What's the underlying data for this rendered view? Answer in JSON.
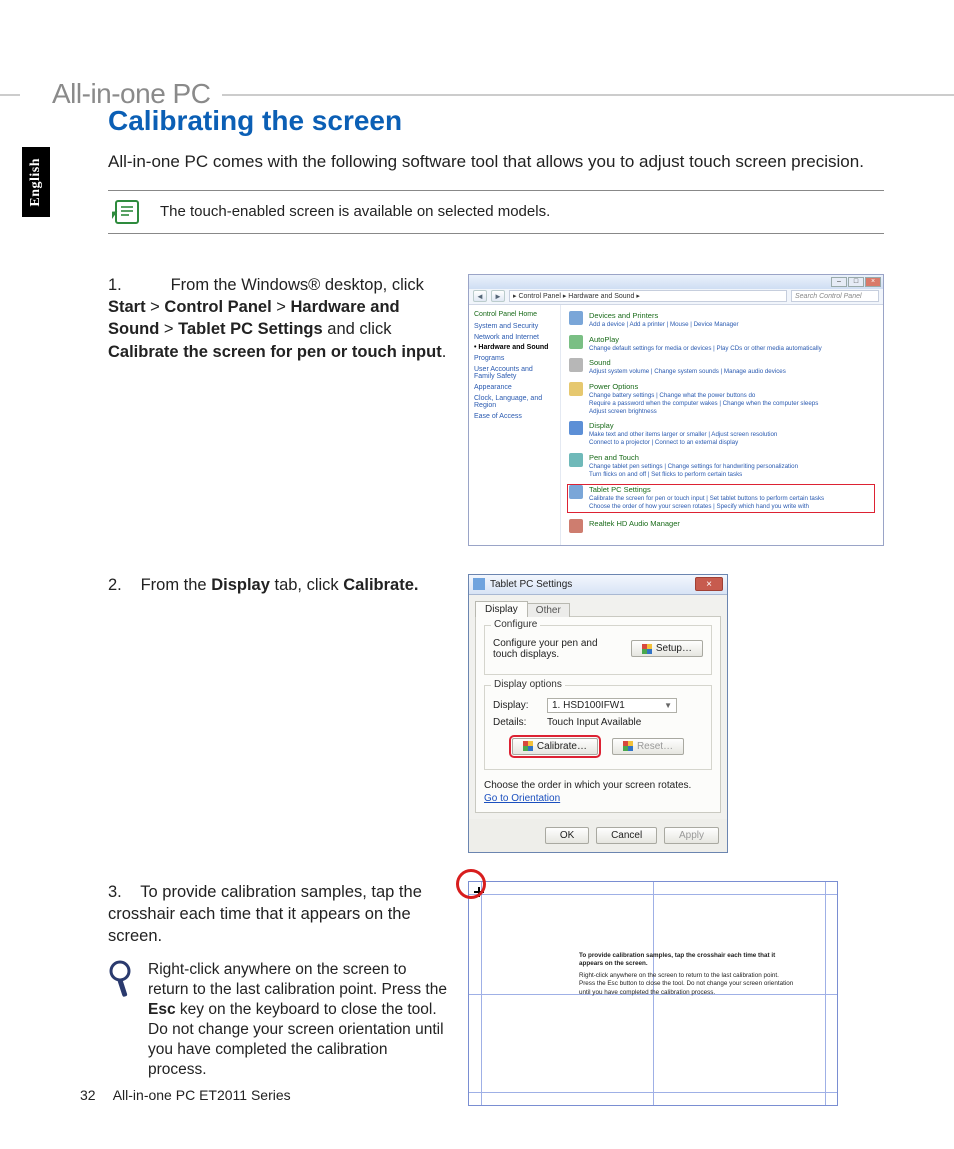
{
  "header": {
    "brand": "All-in-one PC"
  },
  "language_tab": "English",
  "title": "Calibrating the screen",
  "intro": "All-in-one PC comes with the following software tool that allows you to adjust touch screen precision.",
  "note": "The touch-enabled screen is available on selected models.",
  "steps": {
    "s1": {
      "num": "1.",
      "pre": "From the Windows® desktop, click ",
      "b1": "Start",
      "t2": " > ",
      "b2": "Control Panel",
      "t3": " > ",
      "b3": "Hardware and Sound",
      "t4": " > ",
      "b4": "Tablet PC Settings",
      "t5": " and click ",
      "b5": "Calibrate the screen for pen or touch input",
      "t6": "."
    },
    "s2": {
      "num": "2.",
      "pre": "From the ",
      "b1": "Display",
      "t2": " tab, click ",
      "b2": "Calibrate."
    },
    "s3": {
      "num": "3.",
      "text": "To provide calibration samples, tap the crosshair each time that it appears on the screen."
    }
  },
  "tip": {
    "p1": "Right-click anywhere on the screen to return to the last calibration point. Press the ",
    "b1": "Esc",
    "p2": " key on the keyboard to close the tool. Do not change your screen orientation until you have completed the calibration process."
  },
  "cp": {
    "crumbs": "▸ Control Panel ▸ Hardware and Sound ▸",
    "search_placeholder": "Search Control Panel",
    "side_heading": "Control Panel Home",
    "side": [
      "System and Security",
      "Network and Internet",
      "Hardware and Sound",
      "Programs",
      "User Accounts and Family Safety",
      "Appearance",
      "Clock, Language, and Region",
      "Ease of Access"
    ],
    "cats": [
      {
        "title": "Devices and Printers",
        "links": "Add a device | Add a printer | Mouse | Device Manager"
      },
      {
        "title": "AutoPlay",
        "links": "Change default settings for media or devices | Play CDs or other media automatically"
      },
      {
        "title": "Sound",
        "links": "Adjust system volume | Change system sounds | Manage audio devices"
      },
      {
        "title": "Power Options",
        "links": "Change battery settings | Change what the power buttons do\nRequire a password when the computer wakes | Change when the computer sleeps\nAdjust screen brightness"
      },
      {
        "title": "Display",
        "links": "Make text and other items larger or smaller | Adjust screen resolution\nConnect to a projector | Connect to an external display"
      },
      {
        "title": "Pen and Touch",
        "links": "Change tablet pen settings | Change settings for handwriting personalization\nTurn flicks on and off | Set flicks to perform certain tasks"
      },
      {
        "title": "Tablet PC Settings",
        "links": "Calibrate the screen for pen or touch input | Set tablet buttons to perform certain tasks\nChoose the order of how your screen rotates | Specify which hand you write with"
      },
      {
        "title": "Realtek HD Audio Manager",
        "links": ""
      }
    ]
  },
  "dlg": {
    "title": "Tablet PC Settings",
    "tab_display": "Display",
    "tab_other": "Other",
    "grp_configure": "Configure",
    "configure_text": "Configure your pen and touch displays.",
    "btn_setup": "Setup…",
    "grp_options": "Display options",
    "lbl_display": "Display:",
    "sel_display": "1. HSD100IFW1",
    "lbl_details": "Details:",
    "val_details": "Touch Input Available",
    "btn_calibrate": "Calibrate…",
    "btn_reset": "Reset…",
    "rotate_text": "Choose the order in which your screen rotates.",
    "rotate_link": "Go to Orientation",
    "btn_ok": "OK",
    "btn_cancel": "Cancel",
    "btn_apply": "Apply"
  },
  "cal": {
    "l1": "To provide calibration samples, tap the crosshair each time that it appears on the screen.",
    "l2": "Right-click anywhere on the screen to return to the last calibration point. Press the Esc button to close the tool. Do not change your screen orientation until you have completed the calibration process."
  },
  "footer": {
    "page": "32",
    "series": "All-in-one PC ET2011 Series"
  }
}
